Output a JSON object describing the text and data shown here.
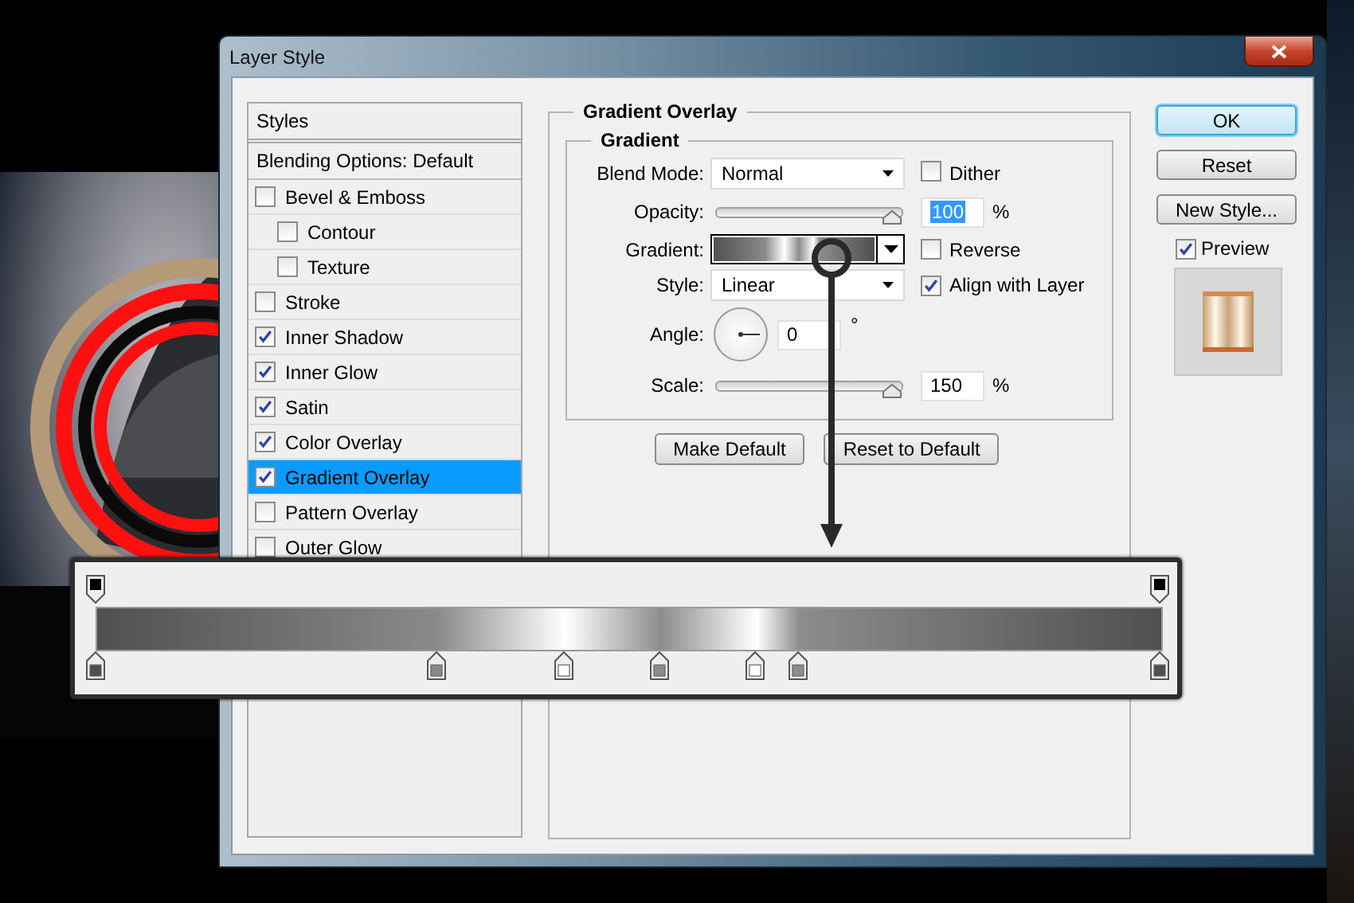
{
  "window": {
    "title": "Layer Style"
  },
  "styles_list": {
    "header": "Styles",
    "blending_options": "Blending Options: Default",
    "items": [
      {
        "label": "Bevel & Emboss",
        "checked": false,
        "selected": false,
        "children": [
          {
            "label": "Contour",
            "checked": false,
            "selected": false
          },
          {
            "label": "Texture",
            "checked": false,
            "selected": false
          }
        ]
      },
      {
        "label": "Stroke",
        "checked": false,
        "selected": false
      },
      {
        "label": "Inner Shadow",
        "checked": true,
        "selected": false
      },
      {
        "label": "Inner Glow",
        "checked": true,
        "selected": false
      },
      {
        "label": "Satin",
        "checked": true,
        "selected": false
      },
      {
        "label": "Color Overlay",
        "checked": true,
        "selected": false
      },
      {
        "label": "Gradient Overlay",
        "checked": true,
        "selected": true
      },
      {
        "label": "Pattern Overlay",
        "checked": false,
        "selected": false
      },
      {
        "label": "Outer Glow",
        "checked": false,
        "selected": false
      }
    ]
  },
  "gradient_overlay": {
    "title": "Gradient Overlay",
    "group": {
      "title": "Gradient",
      "blend_mode": {
        "label": "Blend Mode:",
        "value": "Normal"
      },
      "dither": {
        "label": "Dither",
        "checked": false
      },
      "opacity": {
        "label": "Opacity:",
        "level": 1,
        "value": "100",
        "value_highlighted": true,
        "unit": "%"
      },
      "gradient": {
        "label": "Gradient:"
      },
      "reverse": {
        "label": "Reverse",
        "checked": false
      },
      "style": {
        "label": "Style:",
        "value": "Linear"
      },
      "align_with_layer": {
        "label": "Align with Layer",
        "checked": true
      },
      "angle": {
        "label": "Angle:",
        "value": "0",
        "unit": "°"
      },
      "scale": {
        "label": "Scale:",
        "level": 1,
        "value": "150",
        "value_highlighted": false,
        "unit": "%"
      }
    },
    "buttons": [
      "Make Default",
      "Reset to Default"
    ]
  },
  "actions": {
    "buttons": [
      {
        "label": "OK",
        "default": true
      },
      {
        "label": "Reset",
        "default": false
      },
      {
        "label": "New Style...",
        "default": false
      }
    ],
    "preview": {
      "label": "Preview",
      "checked": true
    }
  },
  "gradient_editor": {
    "opacity_stops": [
      {
        "level": 0,
        "color": "#000000"
      },
      {
        "level": 1,
        "color": "#000000"
      }
    ],
    "color_stops": [
      {
        "level": 0,
        "color": "#505050"
      },
      {
        "level": 0.32,
        "color": "#8a8a8a"
      },
      {
        "level": 0.44,
        "color": "#ffffff"
      },
      {
        "level": 0.53,
        "color": "#8c8c8c"
      },
      {
        "level": 0.62,
        "color": "#ffffff"
      },
      {
        "level": 0.66,
        "color": "#8c8c8c"
      },
      {
        "level": 1,
        "color": "#505050"
      }
    ]
  }
}
